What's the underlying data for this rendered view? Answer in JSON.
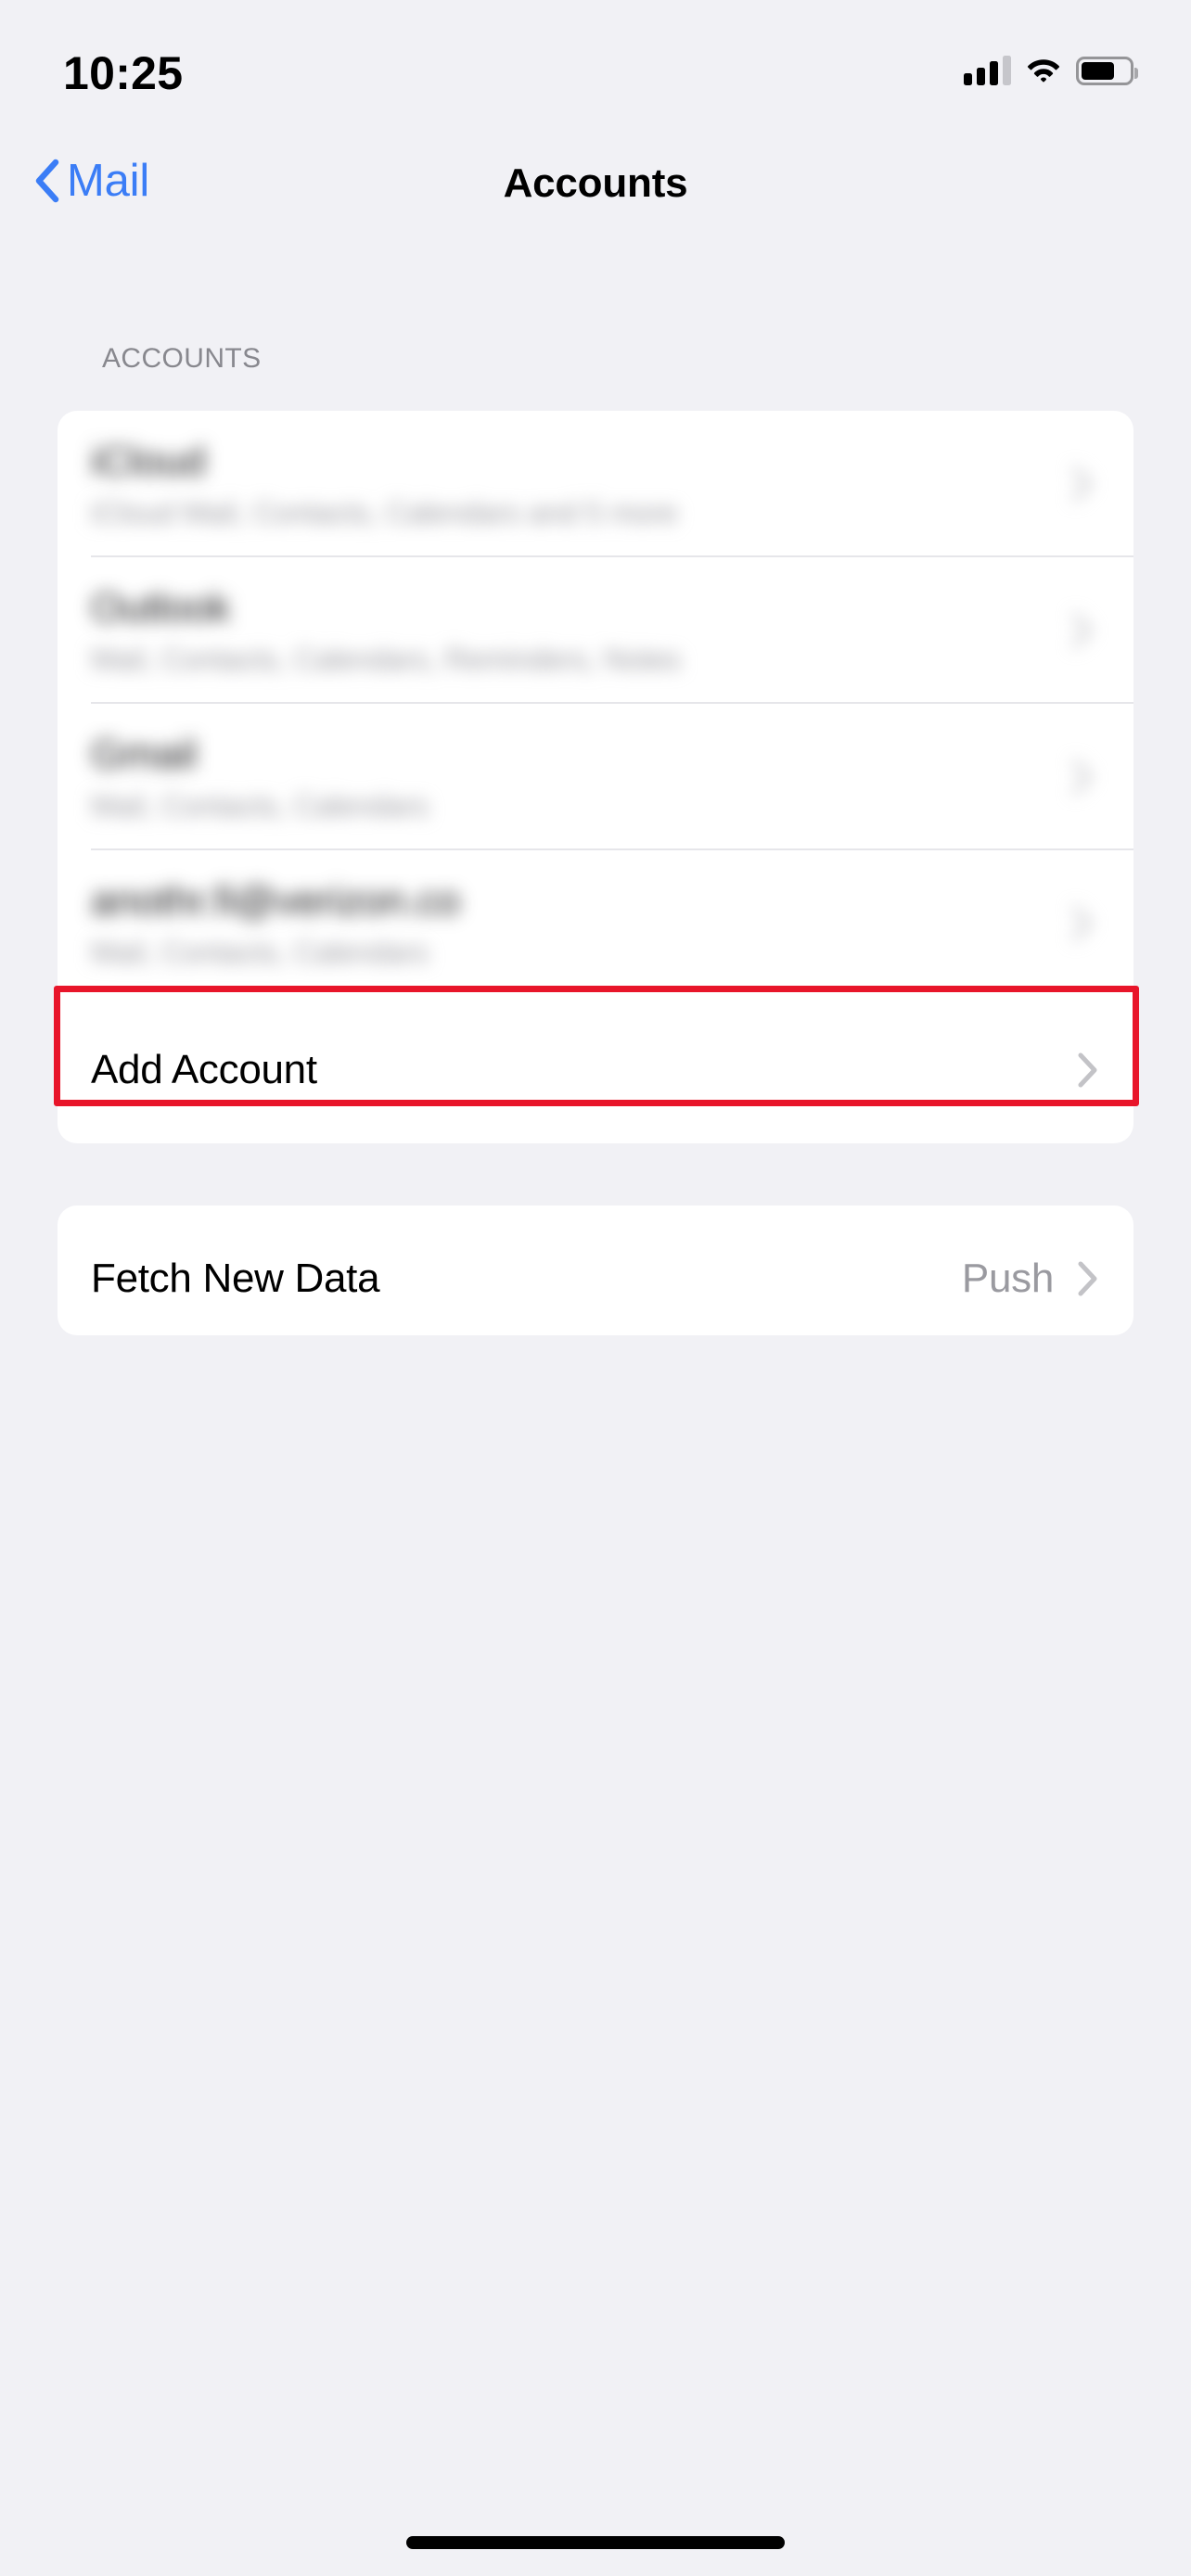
{
  "status_bar": {
    "time": "10:25",
    "cellular_icon": "cellular-signal-icon",
    "cellular_bars_filled": 3,
    "cellular_bars_total": 4,
    "wifi_icon": "wifi-icon",
    "battery_icon": "battery-icon",
    "battery_level_percent": 70
  },
  "nav_bar": {
    "back_icon": "chevron-left-icon",
    "back_label": "Mail",
    "title": "Accounts",
    "accent_color": "#3b7df6"
  },
  "sections": [
    {
      "header": "ACCOUNTS",
      "rows": [
        {
          "title": "iCloud",
          "subtitle": "iCloud Mail, Contacts, Calendars and 5 more",
          "redacted": true,
          "chevron_icon": "chevron-right-icon"
        },
        {
          "title": "Outlook",
          "subtitle": "Mail, Contacts, Calendars, Reminders, Notes",
          "redacted": true,
          "chevron_icon": "chevron-right-icon"
        },
        {
          "title": "Gmail",
          "subtitle": "Mail, Contacts, Calendars",
          "redacted": true,
          "chevron_icon": "chevron-right-icon"
        },
        {
          "title": "anothr.fi@verizon.co",
          "subtitle": "Mail, Contacts, Calendars",
          "redacted": true,
          "chevron_icon": "chevron-right-icon"
        },
        {
          "title": "Add Account",
          "subtitle": "",
          "redacted": false,
          "highlighted": true,
          "chevron_icon": "chevron-right-icon"
        }
      ]
    },
    {
      "header": "",
      "rows": [
        {
          "title": "Fetch New Data",
          "value": "Push",
          "redacted": false,
          "chevron_icon": "chevron-right-icon"
        }
      ]
    }
  ],
  "highlight": {
    "color": "#e8152a",
    "target": "Add Account"
  },
  "home_indicator": "home-indicator"
}
